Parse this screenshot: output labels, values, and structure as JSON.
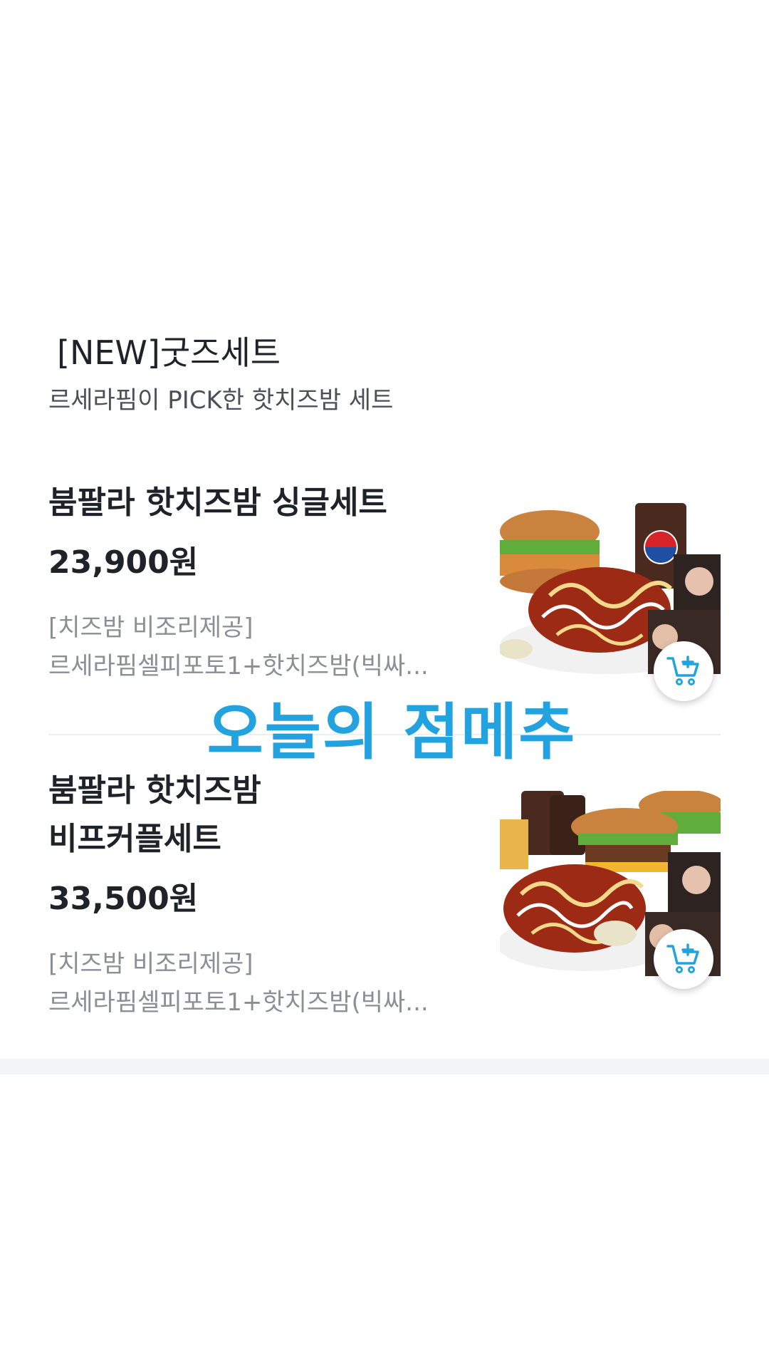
{
  "section": {
    "title": "[NEW]굿즈세트",
    "subtitle": "르세라핌이 PICK한 핫치즈밤 세트"
  },
  "items": [
    {
      "name": "붐팔라 핫치즈밤 싱글세트",
      "price": "23,900원",
      "desc_line1": "[치즈밤 비조리제공]",
      "desc_line2": "르세라핌셀피포토1+핫치즈밤(빅싸...",
      "image_alt": "핫치즈밤 싱글세트 이미지"
    },
    {
      "name_line1": "붐팔라 핫치즈밤",
      "name_line2": "비프커플세트",
      "price": "33,500원",
      "desc_line1": "[치즈밤 비조리제공]",
      "desc_line2": "르세라핌셀피포토1+핫치즈밤(빅싸...",
      "image_alt": "핫치즈밤 비프커플세트 이미지"
    }
  ],
  "overlay": {
    "text": "오늘의 점메추"
  },
  "icons": {
    "cart": "cart-add-icon"
  },
  "colors": {
    "accent": "#22a3e0",
    "text_primary": "#1f2329",
    "text_secondary": "#8a8f96"
  }
}
